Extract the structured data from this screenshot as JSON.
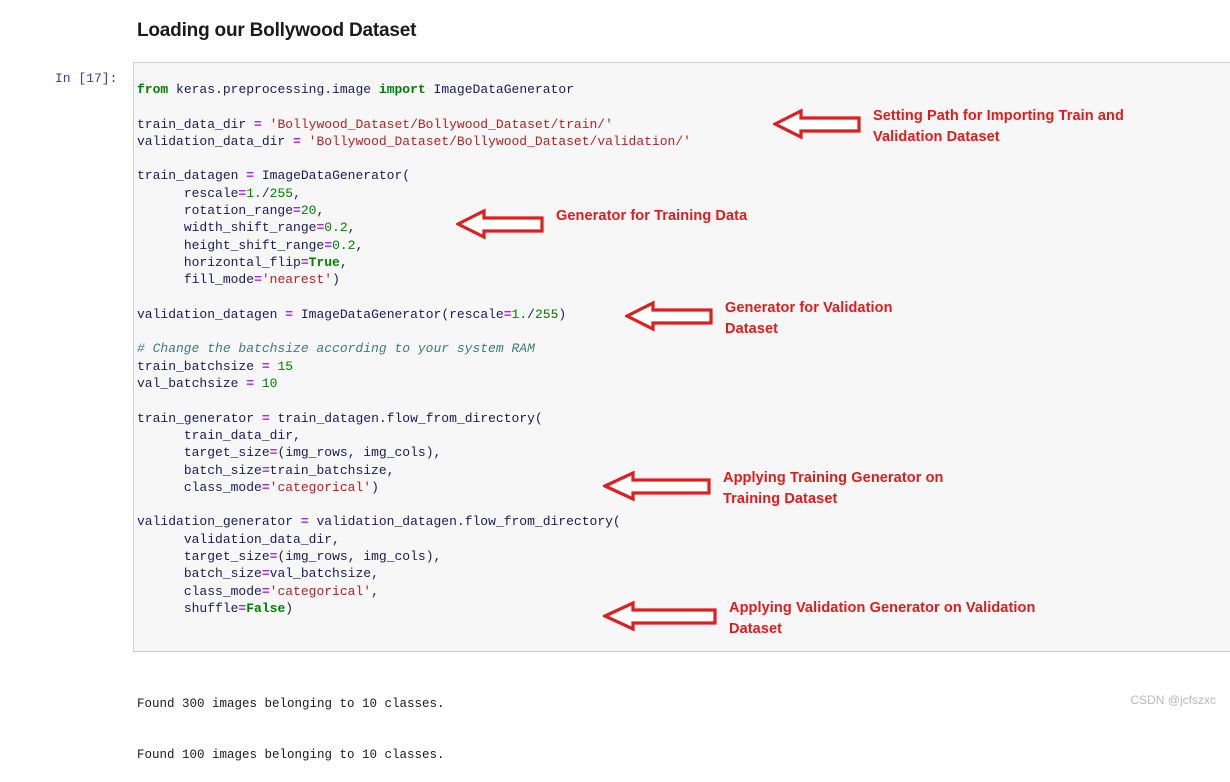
{
  "notebook": {
    "heading": "Loading our Bollywood Dataset",
    "prompt": "In [17]:",
    "watermark": "CSDN @jcfszxc"
  },
  "code": {
    "lines": [
      "from keras.preprocessing.image import ImageDataGenerator",
      "",
      "train_data_dir = 'Bollywood_Dataset/Bollywood_Dataset/train/'",
      "validation_data_dir = 'Bollywood_Dataset/Bollywood_Dataset/validation/'",
      "",
      "train_datagen = ImageDataGenerator(",
      "      rescale=1./255,",
      "      rotation_range=20,",
      "      width_shift_range=0.2,",
      "      height_shift_range=0.2,",
      "      horizontal_flip=True,",
      "      fill_mode='nearest')",
      "",
      "validation_datagen = ImageDataGenerator(rescale=1./255)",
      "",
      "# Change the batchsize according to your system RAM",
      "train_batchsize = 15",
      "val_batchsize = 10",
      "",
      "train_generator = train_datagen.flow_from_directory(",
      "      train_data_dir,",
      "      target_size=(img_rows, img_cols),",
      "      batch_size=train_batchsize,",
      "      class_mode='categorical')",
      "",
      "validation_generator = validation_datagen.flow_from_directory(",
      "      validation_data_dir,",
      "      target_size=(img_rows, img_cols),",
      "      batch_size=val_batchsize,",
      "      class_mode='categorical',",
      "      shuffle=False)"
    ]
  },
  "output": {
    "lines": [
      "Found 300 images belonging to 10 classes.",
      "Found 100 images belonging to 10 classes."
    ]
  },
  "annotations": [
    {
      "text": "Setting Path for Importing Train and\nValidation Dataset"
    },
    {
      "text": "Generator for Training Data"
    },
    {
      "text": "Generator for Validation\nDataset"
    },
    {
      "text": "Applying Training Generator on\nTraining Dataset"
    },
    {
      "text": "Applying Validation Generator on Validation\nDataset"
    }
  ],
  "colors": {
    "annotation_red": "#e01b1b",
    "arrow_stroke": "#dd1f1f",
    "keyword_green": "#008000",
    "string_red": "#ba2121",
    "operator_purple": "#aa22ff",
    "comment_teal": "#3d7b7b",
    "prompt_blue": "#303f9f",
    "cell_background": "#f7f7f7"
  }
}
